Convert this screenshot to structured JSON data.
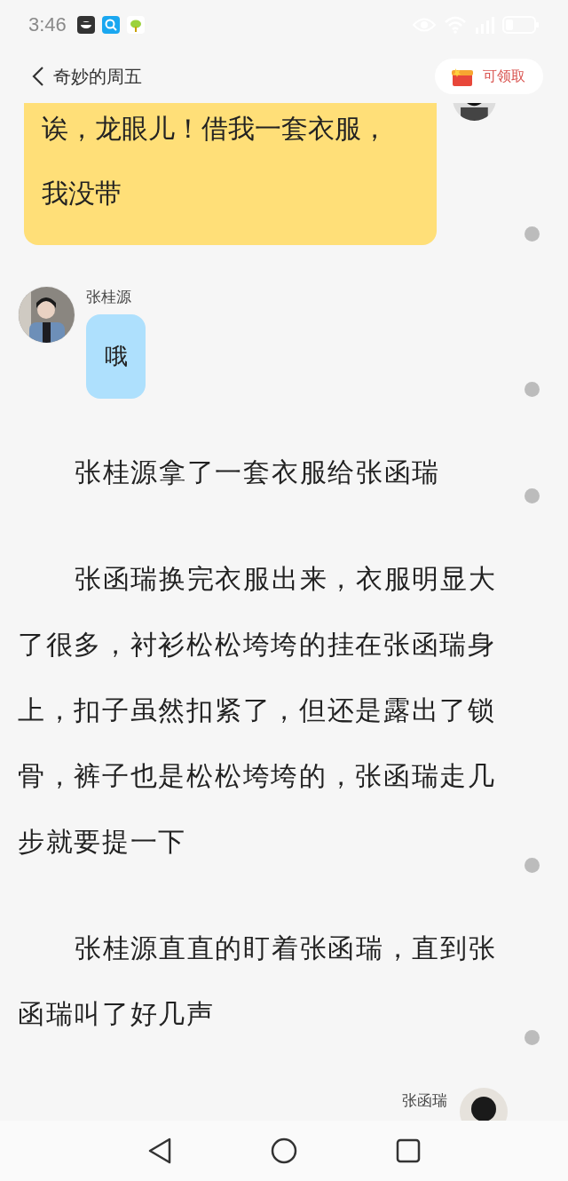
{
  "status_bar": {
    "time": "3:46"
  },
  "header": {
    "title": "奇妙的周五",
    "reward_button": "可领取"
  },
  "feed": [
    {
      "kind": "bubble_right",
      "text": "诶，龙眼儿！借我一套衣服，我没带",
      "color": "#ffdf78"
    },
    {
      "kind": "bubble_left",
      "speaker": "张桂源",
      "text": "哦",
      "color": "#aee0fd"
    },
    {
      "kind": "narration",
      "text": "张桂源拿了一套衣服给张函瑞"
    },
    {
      "kind": "narration",
      "text": "张函瑞换完衣服出来，衣服明显大了很多，衬衫松松垮垮的挂在张函瑞身上，扣子虽然扣紧了，但还是露出了锁骨，裤子也是松松垮垮的，张函瑞走几步就要提一下"
    },
    {
      "kind": "narration",
      "text": "张桂源直直的盯着张函瑞，直到张函瑞叫了好几声"
    },
    {
      "kind": "speaker_right",
      "speaker": "张函瑞"
    }
  ]
}
